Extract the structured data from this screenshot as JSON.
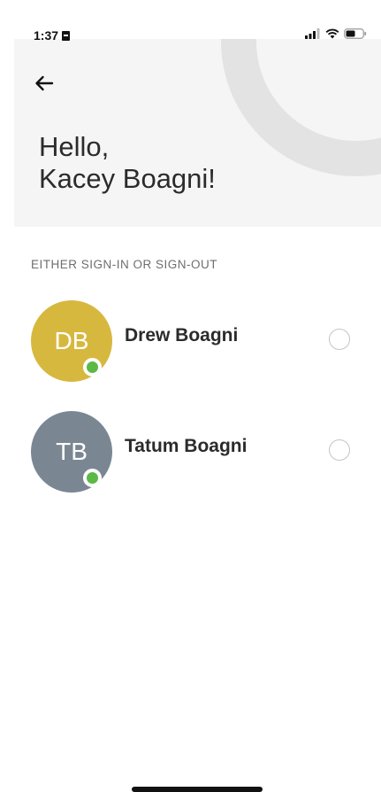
{
  "status_bar": {
    "time": "1:37"
  },
  "header": {
    "greeting_line1": "Hello,",
    "greeting_line2": "Kacey Boagni!"
  },
  "section_title": "EITHER SIGN-IN OR SIGN-OUT",
  "members": [
    {
      "initials": "DB",
      "name": "Drew Boagni",
      "avatar_color": "#d7b83f",
      "online": true,
      "selected": false
    },
    {
      "initials": "TB",
      "name": "Tatum Boagni",
      "avatar_color": "#7a8793",
      "online": true,
      "selected": false
    }
  ],
  "colors": {
    "online": "#5cb946",
    "header_bg": "#f5f5f5",
    "radio_border": "#c4c4c4"
  },
  "icons": [
    "back-arrow-icon",
    "signal-icon",
    "wifi-icon",
    "battery-icon"
  ]
}
